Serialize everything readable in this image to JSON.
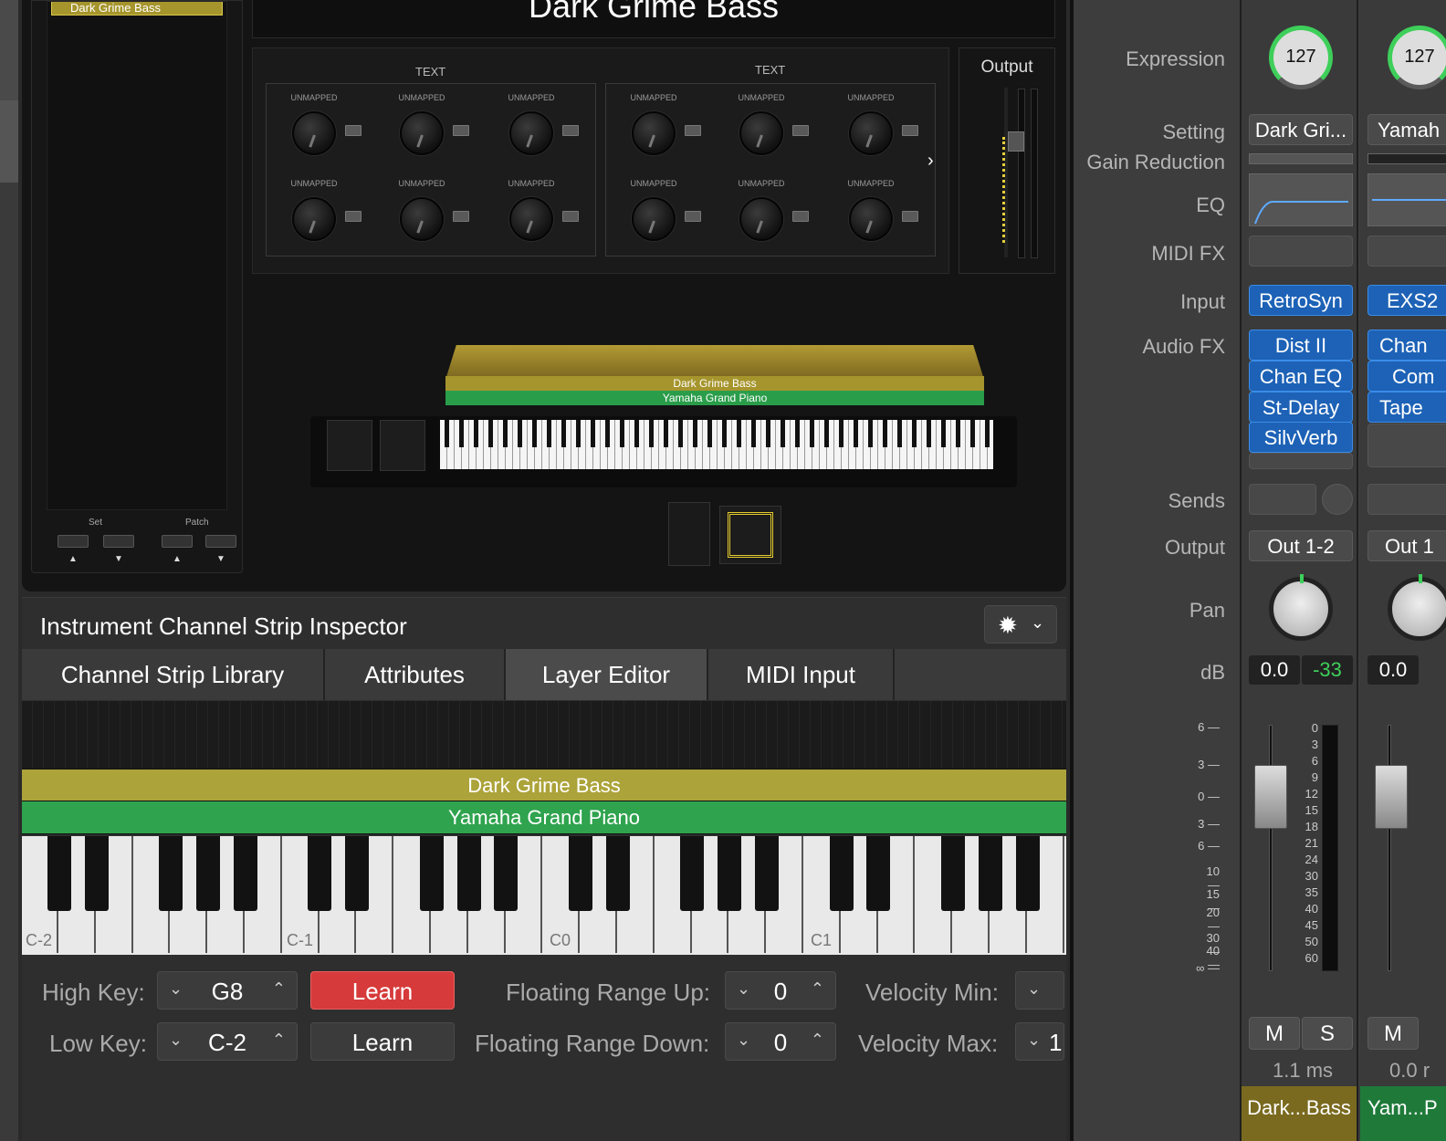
{
  "plugin": {
    "title": "Dark Grime Bass",
    "patch_tag": "Dark Grime Bass",
    "set_label": "Set",
    "patch_label": "Patch",
    "up_arrow": "▲",
    "down_arrow": "▼",
    "group1_title": "TEXT",
    "group2_title": "TEXT",
    "unmapped": "UNMAPPED",
    "output_title": "Output",
    "layer_top": "Dark Grime Bass",
    "layer_bottom": "Yamaha Grand Piano"
  },
  "inspector": {
    "title": "Instrument Channel Strip Inspector",
    "tabs": [
      "Channel Strip Library",
      "Attributes",
      "Layer Editor",
      "MIDI Input"
    ],
    "active_tab": "Layer Editor",
    "layer1": "Dark Grime Bass",
    "layer2": "Yamaha Grand Piano",
    "octaves": [
      "C-2",
      "C-1",
      "C0",
      "C1"
    ],
    "high_key_label": "High Key:",
    "high_key_value": "G8",
    "low_key_label": "Low Key:",
    "low_key_value": "C-2",
    "learn_label": "Learn",
    "float_up_label": "Floating Range Up:",
    "float_up_value": "0",
    "float_down_label": "Floating Range Down:",
    "float_down_value": "0",
    "vel_min_label": "Velocity Min:",
    "vel_max_label": "Velocity Max:",
    "vel_max_value": "1",
    "learn_active_color": "#d63a3a"
  },
  "mixer": {
    "labels": {
      "expression": "Expression",
      "setting": "Setting",
      "gain_reduction": "Gain Reduction",
      "eq": "EQ",
      "midi_fx": "MIDI FX",
      "input": "Input",
      "audio_fx": "Audio FX",
      "sends": "Sends",
      "output": "Output",
      "pan": "Pan",
      "db": "dB"
    },
    "strip1": {
      "expression": "127",
      "setting": "Dark Gri...",
      "input": "RetroSyn",
      "audio_fx": [
        "Dist II",
        "Chan EQ",
        "St-Delay",
        "SilvVerb"
      ],
      "output": "Out 1-2",
      "db_volume": "0.0",
      "db_peak": "-33",
      "mute": "M",
      "solo": "S",
      "latency": "1.1 ms",
      "name": "Dark...Bass",
      "name_color": "#7a6a1f"
    },
    "strip2": {
      "expression": "127",
      "setting": "Yamah",
      "input": "EXS2",
      "audio_fx": [
        "Chan",
        "Com",
        "Tape"
      ],
      "output": "Out 1",
      "db_volume": "0.0",
      "mute": "M",
      "latency": "0.0 r",
      "name": "Yam...P",
      "name_color": "#1f7a3a"
    },
    "fader_scale_left": [
      "6",
      "3",
      "0",
      "3",
      "6",
      "10",
      "15",
      "20",
      "30",
      "40",
      "∞"
    ],
    "fader_scale_right": [
      "0",
      "3",
      "6",
      "9",
      "12",
      "15",
      "18",
      "21",
      "24",
      "30",
      "35",
      "40",
      "45",
      "50",
      "60"
    ]
  }
}
